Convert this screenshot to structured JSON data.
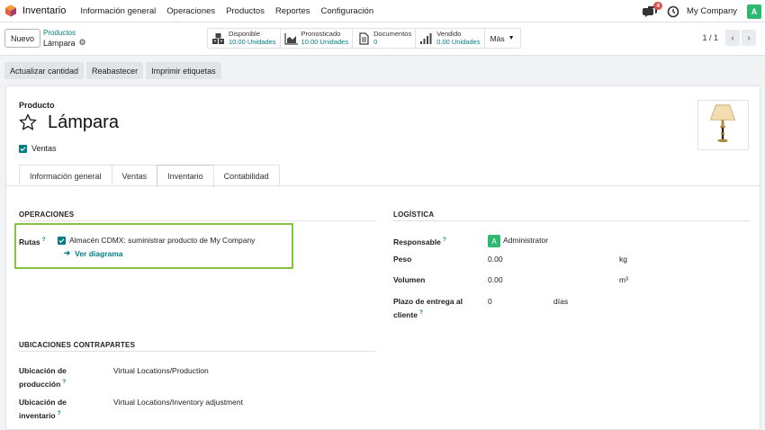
{
  "navbar": {
    "app_name": "Inventario",
    "menu": [
      "Información general",
      "Operaciones",
      "Productos",
      "Reportes",
      "Configuración"
    ],
    "chat_count": "4",
    "company": "My Company",
    "user_initial": "A"
  },
  "control": {
    "new_label": "Nuevo",
    "breadcrumb_parent": "Productos",
    "breadcrumb_current": "Lámpara",
    "stats": [
      {
        "label": "Disponible",
        "value": "10.00 Unidades",
        "icon": "boxes-icon"
      },
      {
        "label": "Pronosticado",
        "value": "10.00 Unidades",
        "icon": "area-chart-icon"
      },
      {
        "label": "Documentos",
        "value": "0",
        "icon": "document-icon"
      },
      {
        "label": "Vendido",
        "value": "0.00 Unidades",
        "icon": "bar-chart-icon"
      }
    ],
    "more_label": "Más",
    "pager": "1 / 1"
  },
  "actions": [
    "Actualizar cantidad",
    "Reabastecer",
    "Imprimir etiquetas"
  ],
  "product": {
    "label": "Producto",
    "name": "Lámpara",
    "sales_label": "Ventas"
  },
  "tabs": [
    "Información general",
    "Ventas",
    "Inventario",
    "Contabilidad"
  ],
  "active_tab": "Inventario",
  "operations": {
    "title": "OPERACIONES",
    "routes_label": "Rutas",
    "route_item": "Almacén CDMX: suministrar producto de My Company",
    "diagram_link": "Ver diagrama"
  },
  "logistics": {
    "title": "LOGÍSTICA",
    "responsible_label": "Responsable",
    "responsible_value": "Administrator",
    "responsible_initial": "A",
    "weight_label": "Peso",
    "weight_value": "0.00",
    "weight_unit": "kg",
    "volume_label": "Volumen",
    "volume_value": "0.00",
    "volume_unit": "m³",
    "lead_label_1": "Plazo de entrega al",
    "lead_label_2": "cliente",
    "lead_value": "0",
    "lead_unit": "días"
  },
  "counterpart": {
    "title": "UBICACIONES CONTRAPARTES",
    "production_label_1": "Ubicación de",
    "production_label_2": "producción",
    "production_value": "Virtual Locations/Production",
    "inventory_label_1": "Ubicación de",
    "inventory_label_2": "inventario",
    "inventory_value": "Virtual Locations/Inventory adjustment"
  },
  "colors": {
    "accent": "#017e84",
    "highlight": "#82c341",
    "avatar": "#2eb872"
  }
}
